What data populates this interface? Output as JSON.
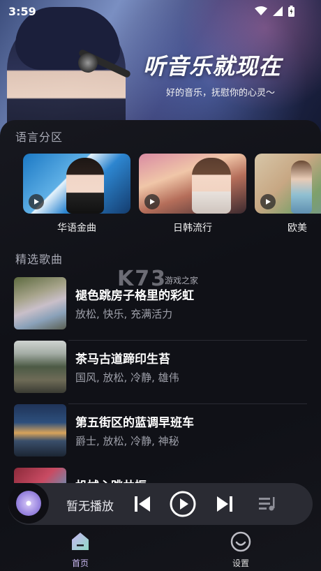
{
  "status": {
    "time": "3:59"
  },
  "hero": {
    "title": "听音乐就现在",
    "subtitle": "好的音乐，抚慰你的心灵～"
  },
  "sections": {
    "languages_title": "语言分区",
    "songs_title": "精选歌曲"
  },
  "categories": [
    {
      "label": "华语金曲"
    },
    {
      "label": "日韩流行"
    },
    {
      "label": "欧美"
    }
  ],
  "songs": [
    {
      "name": "褪色跳房子格里的彩虹",
      "tags": "放松, 快乐, 充满活力"
    },
    {
      "name": "茶马古道蹄印生苔",
      "tags": "国风, 放松, 冷静, 雄伟"
    },
    {
      "name": "第五街区的蓝调早班车",
      "tags": "爵士, 放松, 冷静, 神秘"
    },
    {
      "name": "机械心跳共振",
      "tags": ""
    }
  ],
  "player": {
    "now_playing": "暂无播放"
  },
  "tabs": {
    "home": "首页",
    "settings": "设置"
  },
  "watermark": {
    "logo": "K73",
    "text": "游戏之家"
  },
  "colors": {
    "accent": "#c9b9f2",
    "sheet": "#101117",
    "player": "#2a2b33"
  }
}
